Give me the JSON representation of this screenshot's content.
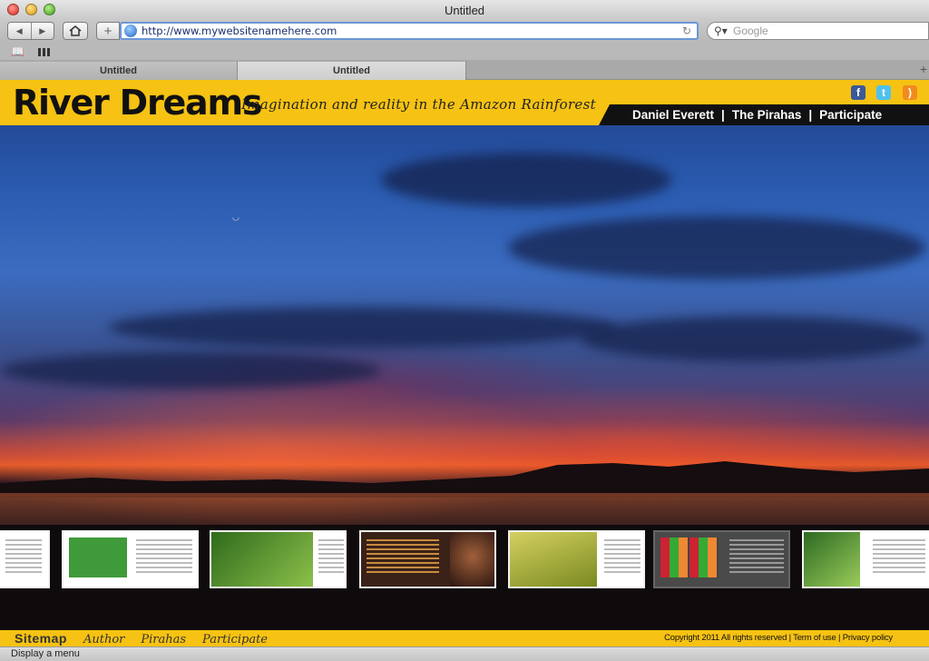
{
  "window": {
    "title": "Untitled"
  },
  "browser": {
    "url": "http://www.mywebsitenamehere.com",
    "search_placeholder": "Google",
    "tabs": [
      {
        "label": "Untitled"
      },
      {
        "label": "Untitled"
      }
    ],
    "status": "Display a menu"
  },
  "site": {
    "brand": "River Dreams",
    "tagline": "Imagination and reality in the Amazon Rainforest",
    "nav": [
      "Daniel Everett",
      "The Pirahas",
      "Participate"
    ],
    "nav_separator": "|",
    "social": [
      {
        "icon": "facebook-icon",
        "glyph": "f",
        "color": "#3b5998"
      },
      {
        "icon": "twitter-icon",
        "glyph": "t",
        "color": "#4ec1ef"
      },
      {
        "icon": "rss-icon",
        "glyph": ")",
        "color": "#f28b1e"
      }
    ],
    "footer": {
      "sitemap": "Sitemap",
      "links": [
        "Author",
        "Pirahas",
        "Participate"
      ],
      "legal": "Copyright 2011 All rights reserved | Term of use | Privacy policy"
    },
    "accent_color": "#f6c213",
    "thumbnails": [
      {
        "name": "spread-1",
        "pic_color": "#ffffff"
      },
      {
        "name": "spread-2",
        "pic_color": "#3f9a3a"
      },
      {
        "name": "spread-3",
        "pic_color": "#5f9b2c"
      },
      {
        "name": "spread-4",
        "pic_color": "#3a2218"
      },
      {
        "name": "spread-5",
        "pic_color": "#b8b63a"
      },
      {
        "name": "spread-6",
        "pic_color": "#444444"
      },
      {
        "name": "spread-7",
        "pic_color": "#4f8f2e"
      }
    ]
  }
}
